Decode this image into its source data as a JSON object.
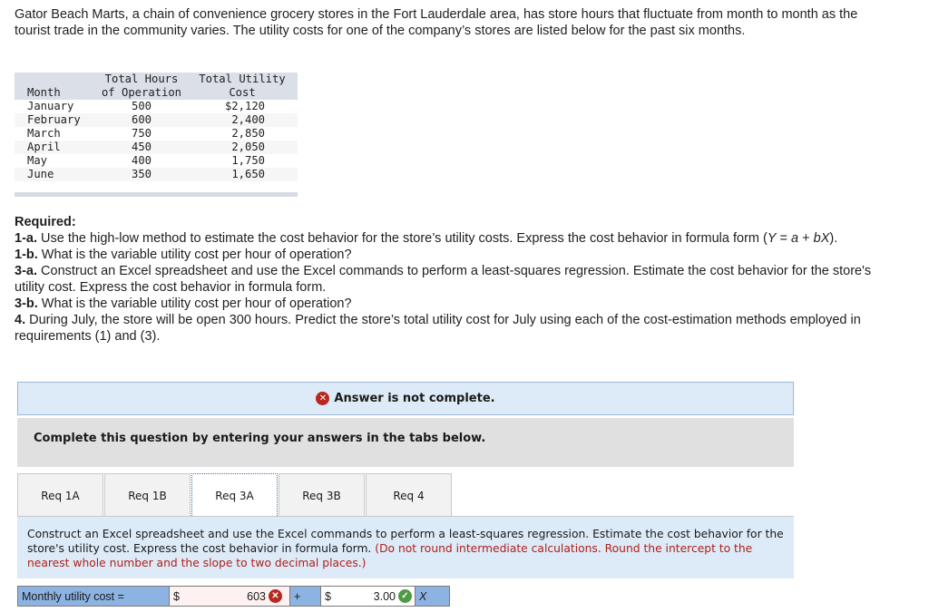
{
  "intro": "Gator Beach Marts, a chain of convenience grocery stores in the Fort Lauderdale area, has store hours that fluctuate from month to month as the tourist trade in the community varies. The utility costs for one of the company’s stores are listed below for the past six months.",
  "table": {
    "headers": {
      "month": "Month",
      "hours_line1": "Total Hours",
      "hours_line2": "of Operation",
      "cost_line1": "Total Utility",
      "cost_line2": "Cost"
    },
    "rows": [
      {
        "month": "January",
        "hours": "500",
        "cost": "$2,120"
      },
      {
        "month": "February",
        "hours": "600",
        "cost": "2,400"
      },
      {
        "month": "March",
        "hours": "750",
        "cost": "2,850"
      },
      {
        "month": "April",
        "hours": "450",
        "cost": "2,050"
      },
      {
        "month": "May",
        "hours": "400",
        "cost": "1,750"
      },
      {
        "month": "June",
        "hours": "350",
        "cost": "1,650"
      }
    ]
  },
  "required": {
    "title": "Required:",
    "items": [
      {
        "num": "1-a.",
        "text": " Use the high-low method to estimate the cost behavior for the store’s utility costs. Express the cost behavior in formula form (",
        "formula": "Y",
        "text2": " = ",
        "formula2": "a",
        "text3": " + ",
        "formula3": "bX",
        "text4": ")."
      },
      {
        "num": "1-b.",
        "text": " What is the variable utility cost per hour of operation?"
      },
      {
        "num": "3-a.",
        "text": " Construct an Excel spreadsheet and use the Excel commands to perform a least-squares regression. Estimate the cost behavior for the store's utility cost. Express the cost behavior in formula form."
      },
      {
        "num": "3-b.",
        "text": " What is the variable utility cost per hour of operation?"
      },
      {
        "num": "4.",
        "text": " During July, the store will be open 300 hours. Predict the store’s total utility cost for July using each of the cost-estimation methods employed in requirements (1) and (3)."
      }
    ]
  },
  "status": {
    "icon": "x-circle-icon",
    "text": "Answer is not complete.",
    "color": "#b8281e"
  },
  "instructions": "Complete this question by entering your answers in the tabs below.",
  "tabs": [
    {
      "label": "Req 1A",
      "active": false
    },
    {
      "label": "Req 1B",
      "active": false
    },
    {
      "label": "Req 3A",
      "active": true
    },
    {
      "label": "Req 3B",
      "active": false
    },
    {
      "label": "Req 4",
      "active": false
    }
  ],
  "panel": {
    "text": "Construct an Excel spreadsheet and use the Excel commands to perform a least-squares regression. Estimate the cost behavior for the store's utility cost. Express the cost behavior in formula form. ",
    "hint": "(Do not round intermediate calculations. Round the intercept to the nearest whole number and the slope to two decimal places.)"
  },
  "answer": {
    "label": "Monthly utility cost =",
    "currency1": "$",
    "intercept": "603",
    "intercept_status": "incorrect",
    "plus": "+",
    "currency2": "$",
    "slope": "3.00",
    "slope_status": "correct",
    "variable": "X",
    "x_glyph": "✕",
    "check_glyph": "✓"
  }
}
